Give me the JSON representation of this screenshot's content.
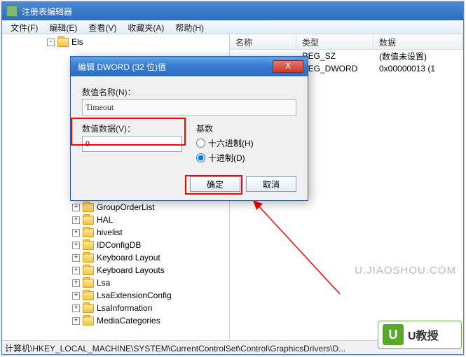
{
  "window": {
    "title": "注册表编辑器"
  },
  "menu": {
    "file": "文件(F)",
    "edit": "编辑(E)",
    "view": "查看(V)",
    "fav": "收藏夹(A)",
    "help": "帮助(H)"
  },
  "tree": {
    "top": "Els",
    "items": [
      "GroupOrderList",
      "HAL",
      "hivelist",
      "IDConfigDB",
      "Keyboard Layout",
      "Keyboard Layouts",
      "Lsa",
      "LsaExtensionConfig",
      "LsaInformation",
      "MediaCategories"
    ]
  },
  "list": {
    "head": {
      "name": "名称",
      "type": "类型",
      "data": "数据"
    },
    "rows": [
      {
        "type": "REG_SZ",
        "data": "(数值未设置)"
      },
      {
        "type": "REG_DWORD",
        "data": "0x00000013 (1"
      }
    ]
  },
  "status": "计算机\\HKEY_LOCAL_MACHINE\\SYSTEM\\CurrentControlSet\\Control\\GraphicsDrivers\\D...",
  "dialog": {
    "title": "编辑 DWORD (32 位)值",
    "name_label": "数值名称(N)：",
    "name_value": "Timeout",
    "data_label": "数值数据(V)：",
    "data_value": "0",
    "base_label": "基数",
    "hex": "十六进制(H)",
    "dec": "十进制(D)",
    "ok": "确定",
    "cancel": "取消",
    "close": "X"
  },
  "watermark": "U.JIAOSHOU.COM",
  "badge": {
    "icon": "U",
    "text": "U教授"
  }
}
